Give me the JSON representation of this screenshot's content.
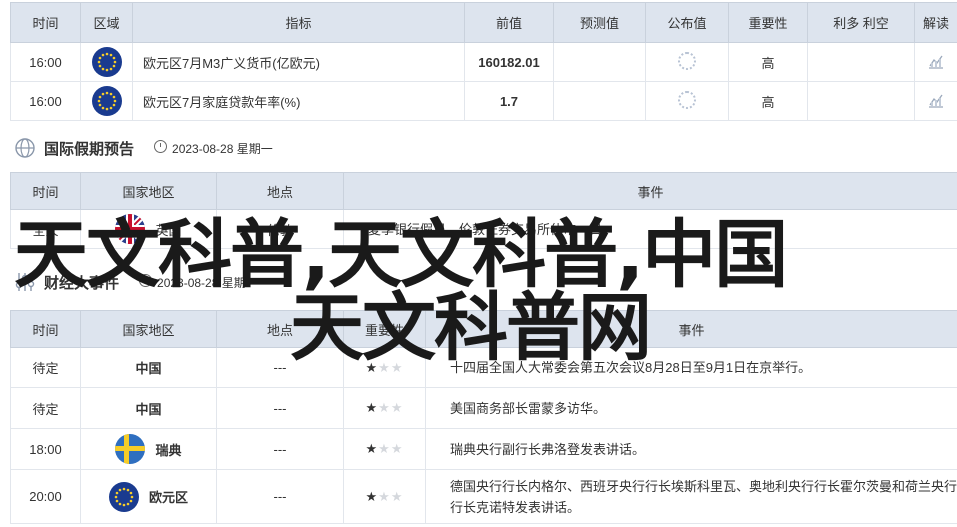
{
  "econ_table": {
    "headers": [
      "时间",
      "区域",
      "指标",
      "前值",
      "预测值",
      "公布值",
      "重要性",
      "利多 利空",
      "解读"
    ],
    "rows": [
      {
        "time": "16:00",
        "region_flag": "eu-flag",
        "indicator": "欧元区7月M3广义货币(亿欧元)",
        "prev": "160182.01",
        "importance": "高"
      },
      {
        "time": "16:00",
        "region_flag": "eu-flag",
        "indicator": "欧元区7月家庭贷款年率(%)",
        "prev": "1.7",
        "importance": "高"
      }
    ]
  },
  "holiday_section": {
    "title": "国际假期预告",
    "date": "2023-08-28 星期一"
  },
  "holiday_table": {
    "headers": [
      "时间",
      "国家地区",
      "地点",
      "事件"
    ],
    "rows": [
      {
        "time": "全天",
        "country": "英国",
        "place": "伦敦",
        "event": "夏季银行假日，伦敦证券交易所休市一日"
      }
    ]
  },
  "finance_section": {
    "title": "财经大事件",
    "date": "2023-08-28 星期一"
  },
  "finance_table": {
    "headers": [
      "时间",
      "国家地区",
      "地点",
      "重要性",
      "事件"
    ],
    "rows": [
      {
        "time": "待定",
        "country": "中国",
        "place": "---",
        "stars": 1,
        "event": "十四届全国人大常委会第五次会议8月28日至9月1日在京举行。"
      },
      {
        "time": "待定",
        "country": "中国",
        "place": "---",
        "stars": 1,
        "event": "美国商务部长雷蒙多访华。"
      },
      {
        "time": "18:00",
        "country": "瑞典",
        "place": "---",
        "stars": 1,
        "event": "瑞典央行副行长弗洛登发表讲话。"
      },
      {
        "time": "20:00",
        "country": "欧元区",
        "place": "---",
        "stars": 1,
        "event": "德国央行行长内格尔、西班牙央行行长埃斯科里瓦、奥地利央行行长霍尔茨曼和荷兰央行行长克诺特发表讲话。"
      }
    ]
  },
  "watermark": {
    "line1": "天文科普,天文科普,中国",
    "line2": "天文科普网"
  },
  "colors": {
    "header_bg": "#dde4ee",
    "accent_red": "#c81e1e",
    "star": "#f2b01e"
  }
}
